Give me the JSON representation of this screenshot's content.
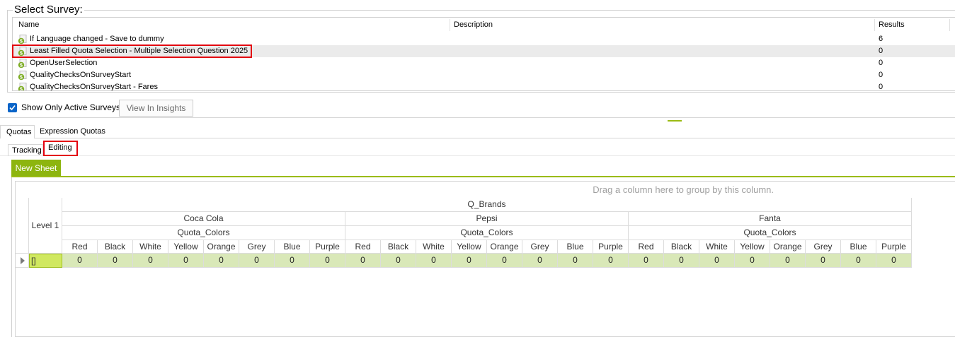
{
  "select_survey": {
    "title": "Select Survey:",
    "columns": {
      "name": "Name",
      "description": "Description",
      "results": "Results"
    },
    "rows": [
      {
        "name": "If Language changed - Save to dummy",
        "description": "",
        "results": "6",
        "selected": false
      },
      {
        "name": "Least Filled Quota Selection - Multiple Selection Question 2025",
        "description": "",
        "results": "0",
        "selected": true
      },
      {
        "name": "OpenUserSelection",
        "description": "",
        "results": "0",
        "selected": false
      },
      {
        "name": "QualityChecksOnSurveyStart",
        "description": "",
        "results": "0",
        "selected": false
      },
      {
        "name": "QualityChecksOnSurveyStart - Fares",
        "description": "",
        "results": "0",
        "selected": false
      }
    ]
  },
  "options": {
    "show_active_label": "Show Only Active Surveys",
    "show_active_checked": true,
    "view_insights_label": "View In Insights"
  },
  "tabs": {
    "quotas": "Quotas",
    "expression_quotas": "Expression Quotas"
  },
  "subtabs": {
    "tracking": "Tracking",
    "editing": "Editing"
  },
  "sheet": {
    "new_sheet_label": "New Sheet"
  },
  "grid": {
    "group_panel_text": "Drag a column here to group by this column.",
    "row_header_label": "Level 1",
    "top_header": "Q_Brands",
    "brands": [
      {
        "name": "Coca Cola",
        "sub": "Quota_Colors"
      },
      {
        "name": "Pepsi",
        "sub": "Quota_Colors"
      },
      {
        "name": "Fanta",
        "sub": "Quota_Colors"
      }
    ],
    "colors": [
      "Red",
      "Black",
      "White",
      "Yellow",
      "Orange",
      "Grey",
      "Blue",
      "Purple"
    ],
    "row": {
      "key": "[]",
      "values": [
        "0",
        "0",
        "0",
        "0",
        "0",
        "0",
        "0",
        "0",
        "0",
        "0",
        "0",
        "0",
        "0",
        "0",
        "0",
        "0",
        "0",
        "0",
        "0",
        "0",
        "0",
        "0",
        "0",
        "0"
      ]
    }
  },
  "accent_color": "#8db50f",
  "highlight_color": "#e3000f"
}
